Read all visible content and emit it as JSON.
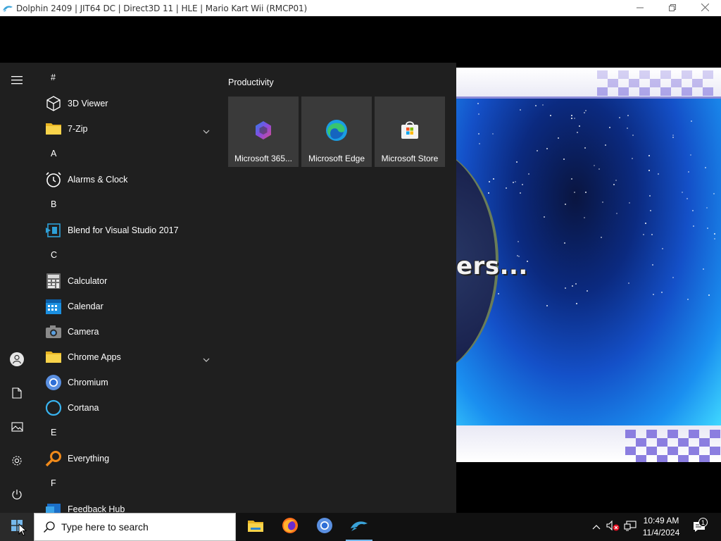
{
  "window": {
    "title": "Dolphin 2409 | JIT64 DC | Direct3D 11 | HLE | Mario Kart Wii (RMCP01)",
    "controls": [
      "minimize-icon",
      "restore-icon",
      "close-icon"
    ]
  },
  "game": {
    "loading_text": "ers..."
  },
  "start_menu": {
    "rail": {
      "menu_icon": "hamburger-icon",
      "items": [
        {
          "name": "user-account",
          "icon": "person-icon"
        },
        {
          "name": "documents",
          "icon": "document-icon"
        },
        {
          "name": "pictures",
          "icon": "pictures-icon"
        },
        {
          "name": "settings",
          "icon": "gear-icon"
        },
        {
          "name": "power",
          "icon": "power-icon"
        }
      ]
    },
    "apps": [
      {
        "type": "letter",
        "label": "#"
      },
      {
        "type": "app",
        "label": "3D Viewer",
        "icon": "cube-icon"
      },
      {
        "type": "app",
        "label": "7-Zip",
        "icon": "folder-icon",
        "expandable": true
      },
      {
        "type": "letter",
        "label": "A"
      },
      {
        "type": "app",
        "label": "Alarms & Clock",
        "icon": "alarm-clock-icon"
      },
      {
        "type": "letter",
        "label": "B"
      },
      {
        "type": "app",
        "label": "Blend for Visual Studio 2017",
        "icon": "blend-icon"
      },
      {
        "type": "letter",
        "label": "C"
      },
      {
        "type": "app",
        "label": "Calculator",
        "icon": "calculator-icon"
      },
      {
        "type": "app",
        "label": "Calendar",
        "icon": "calendar-icon"
      },
      {
        "type": "app",
        "label": "Camera",
        "icon": "camera-icon"
      },
      {
        "type": "app",
        "label": "Chrome Apps",
        "icon": "folder-icon",
        "expandable": true
      },
      {
        "type": "app",
        "label": "Chromium",
        "icon": "chromium-icon"
      },
      {
        "type": "app",
        "label": "Cortana",
        "icon": "cortana-icon"
      },
      {
        "type": "letter",
        "label": "E"
      },
      {
        "type": "app",
        "label": "Everything",
        "icon": "magnifier-icon"
      },
      {
        "type": "letter",
        "label": "F"
      },
      {
        "type": "app",
        "label": "Feedback Hub",
        "icon": "feedback-icon"
      }
    ],
    "tiles_group": "Productivity",
    "tiles": [
      {
        "label": "Microsoft 365...",
        "icon": "microsoft-365-icon"
      },
      {
        "label": "Microsoft Edge",
        "icon": "edge-icon"
      },
      {
        "label": "Microsoft Store",
        "icon": "store-icon"
      }
    ]
  },
  "taskbar": {
    "start_icon": "windows-start-icon",
    "search": {
      "placeholder": "Type here to search",
      "icon": "search-icon"
    },
    "pinned": [
      {
        "name": "file-explorer",
        "icon": "file-explorer-icon",
        "active": false
      },
      {
        "name": "firefox",
        "icon": "firefox-icon",
        "active": false
      },
      {
        "name": "chromium",
        "icon": "chromium-icon",
        "active": false
      },
      {
        "name": "dolphin",
        "icon": "dolphin-icon",
        "active": true
      }
    ],
    "tray": {
      "icons": [
        "chevron-up-icon",
        "volume-muted-icon",
        "network-icon"
      ],
      "time": "10:49 AM",
      "date": "11/4/2024",
      "notification_count": "1"
    }
  },
  "colors": {
    "menu_bg": "#1f1f1f",
    "tile_bg": "#3a3a3a",
    "taskbar_bg": "#111111",
    "accent": "#76b9ed"
  }
}
